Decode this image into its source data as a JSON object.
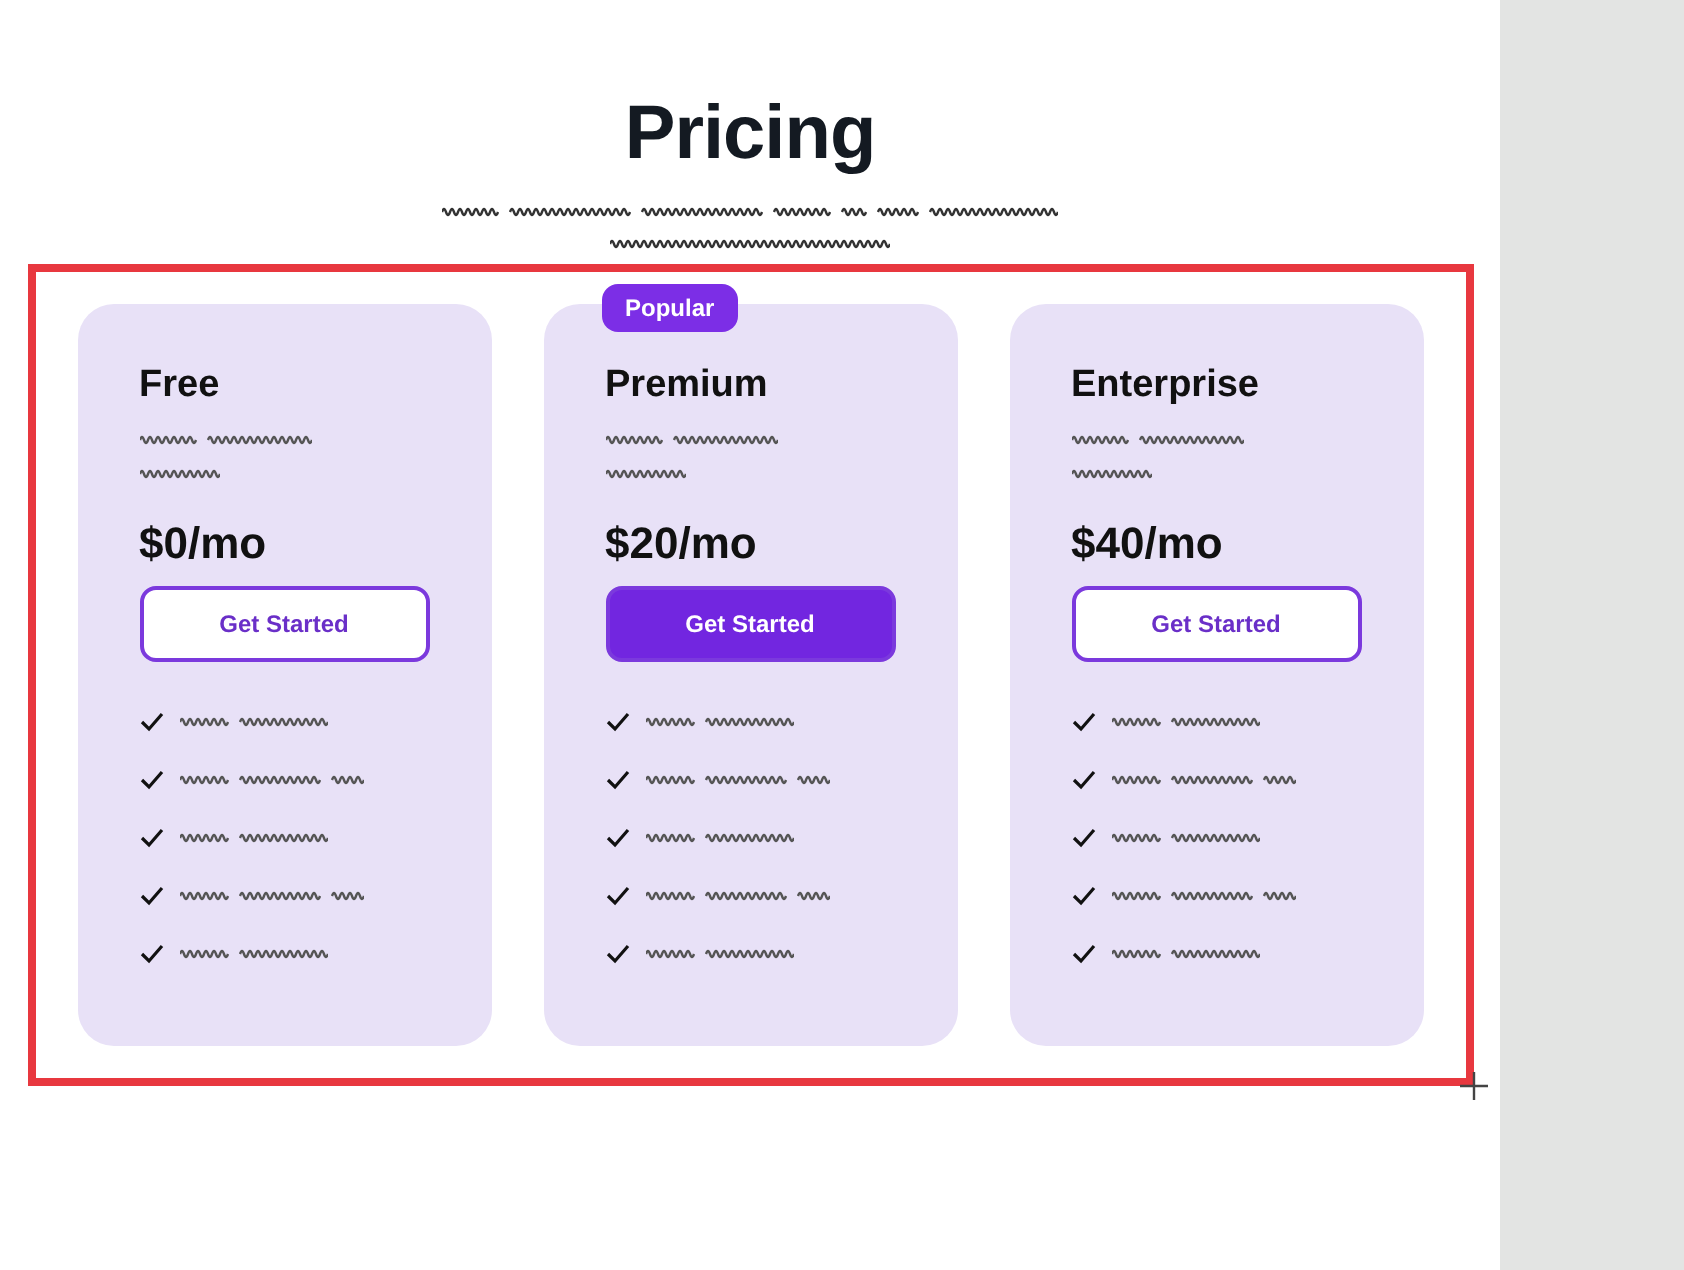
{
  "heading": "Pricing",
  "plans": [
    {
      "name": "Free",
      "price": "$0/mo",
      "featured": false,
      "button": "Get Started",
      "features": [
        {
          "checked": true
        },
        {
          "checked": true
        },
        {
          "checked": true
        },
        {
          "checked": true
        },
        {
          "checked": true
        }
      ]
    },
    {
      "name": "Premium",
      "price": "$20/mo",
      "featured": true,
      "badge": "Popular",
      "button": "Get Started",
      "features": [
        {
          "checked": true
        },
        {
          "checked": true
        },
        {
          "checked": true
        },
        {
          "checked": true
        },
        {
          "checked": true
        }
      ]
    },
    {
      "name": "Enterprise",
      "price": "$40/mo",
      "featured": false,
      "button": "Get Started",
      "features": [
        {
          "checked": true
        },
        {
          "checked": true
        },
        {
          "checked": true
        },
        {
          "checked": true
        },
        {
          "checked": true
        }
      ]
    }
  ],
  "selection": {
    "selected": true
  }
}
